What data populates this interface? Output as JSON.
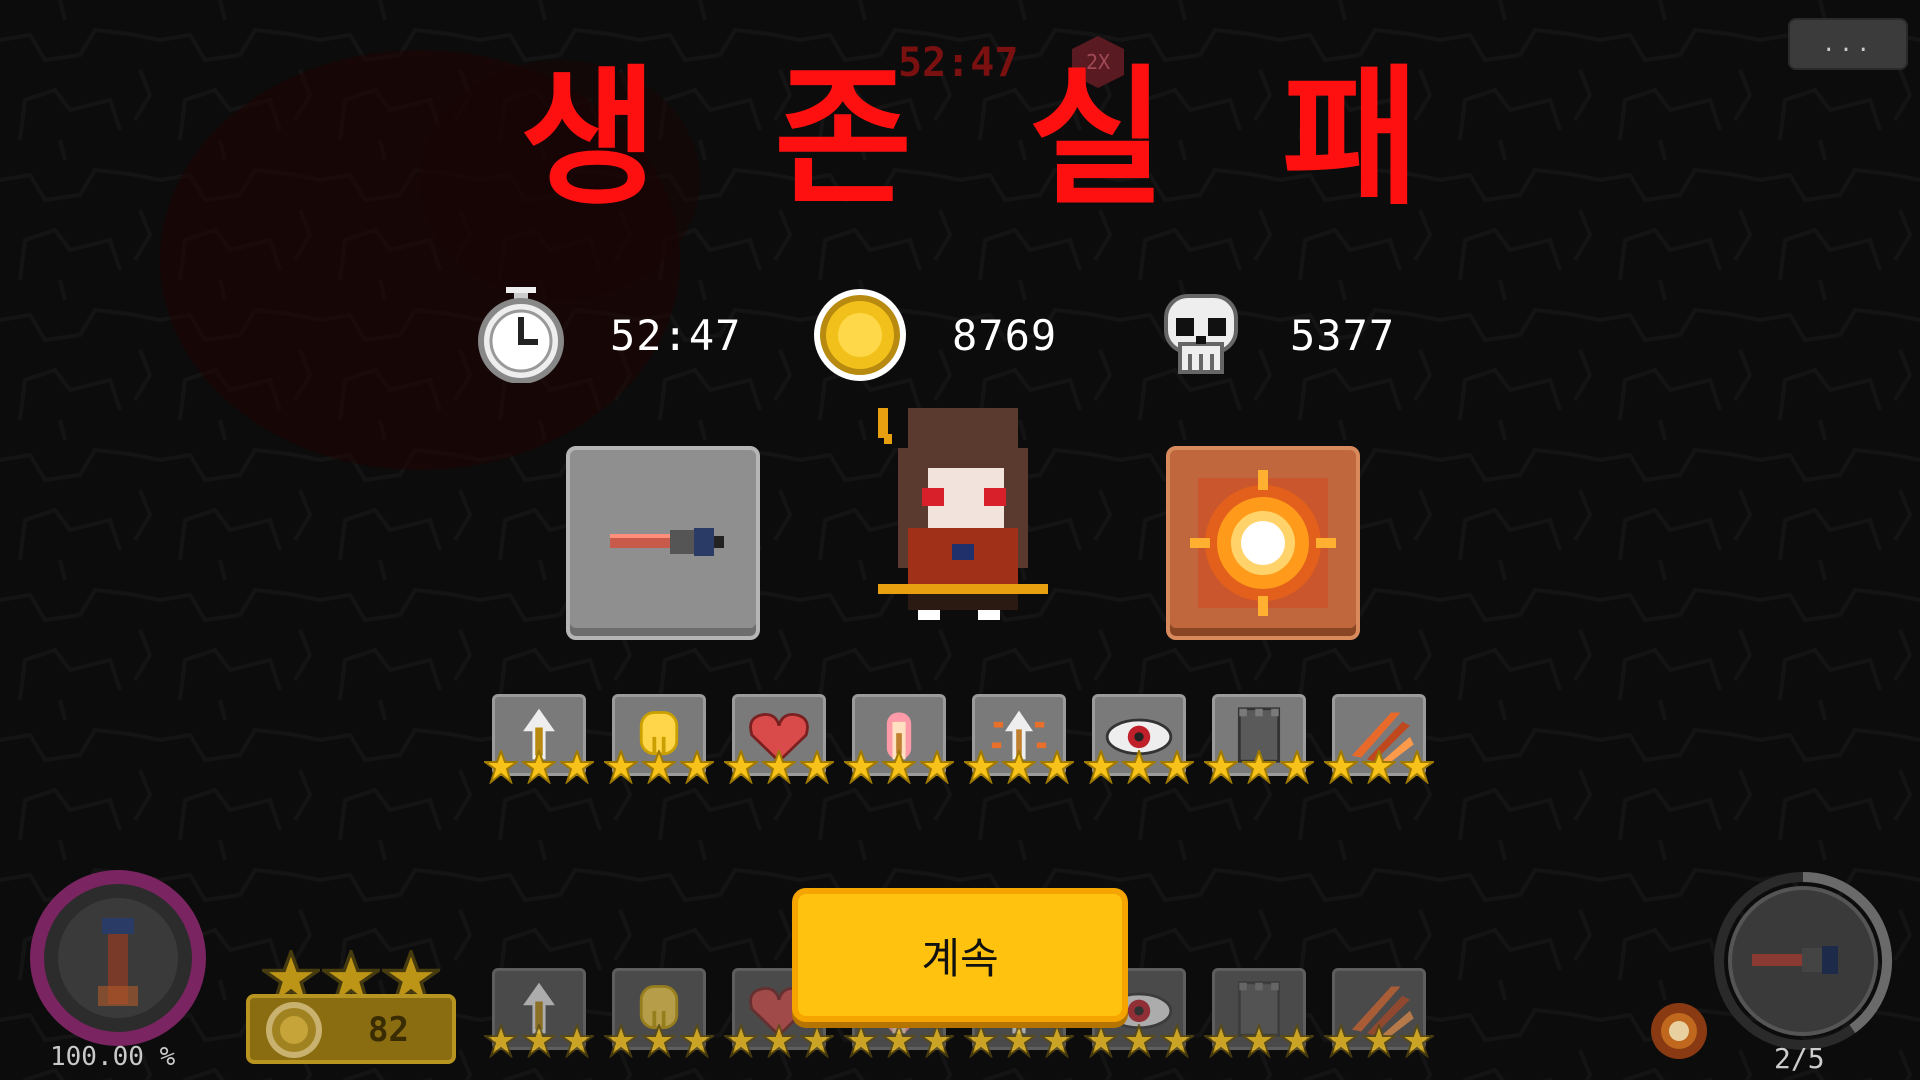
{
  "game": {
    "title_chars": [
      "생",
      "존",
      "실",
      "패"
    ],
    "background_timer": "52:47",
    "speed_badge": "2X",
    "menu_label": "...",
    "continue_label": "계속"
  },
  "stats": {
    "time": {
      "icon": "stopwatch-icon",
      "value": "52:47"
    },
    "gold": {
      "icon": "coin-icon",
      "value": "8769"
    },
    "kills": {
      "icon": "skull-icon",
      "value": "5377"
    }
  },
  "equipment": {
    "weapon": "pixel-torch-weapon-icon",
    "skill": "sun-burst-skill-icon"
  },
  "passives": [
    {
      "icon": "arrow-up-icon",
      "stars": 3
    },
    {
      "icon": "shield-icon",
      "stars": 3
    },
    {
      "icon": "heart-icon",
      "stars": 3
    },
    {
      "icon": "pink-arrow-icon",
      "stars": 3
    },
    {
      "icon": "speed-arrow-icon",
      "stars": 3
    },
    {
      "icon": "eye-icon",
      "stars": 3
    },
    {
      "icon": "tower-icon",
      "stars": 3
    },
    {
      "icon": "slash-icon",
      "stars": 3
    }
  ],
  "hud": {
    "hp_percent": "100.00 %",
    "coins": "82",
    "player_stars": 3,
    "weapon_count": "2/5",
    "weapon_progress": 0.4
  },
  "colors": {
    "title": "#ff1010",
    "continue_button": "#ffc20e",
    "star": "#f7c21a"
  }
}
